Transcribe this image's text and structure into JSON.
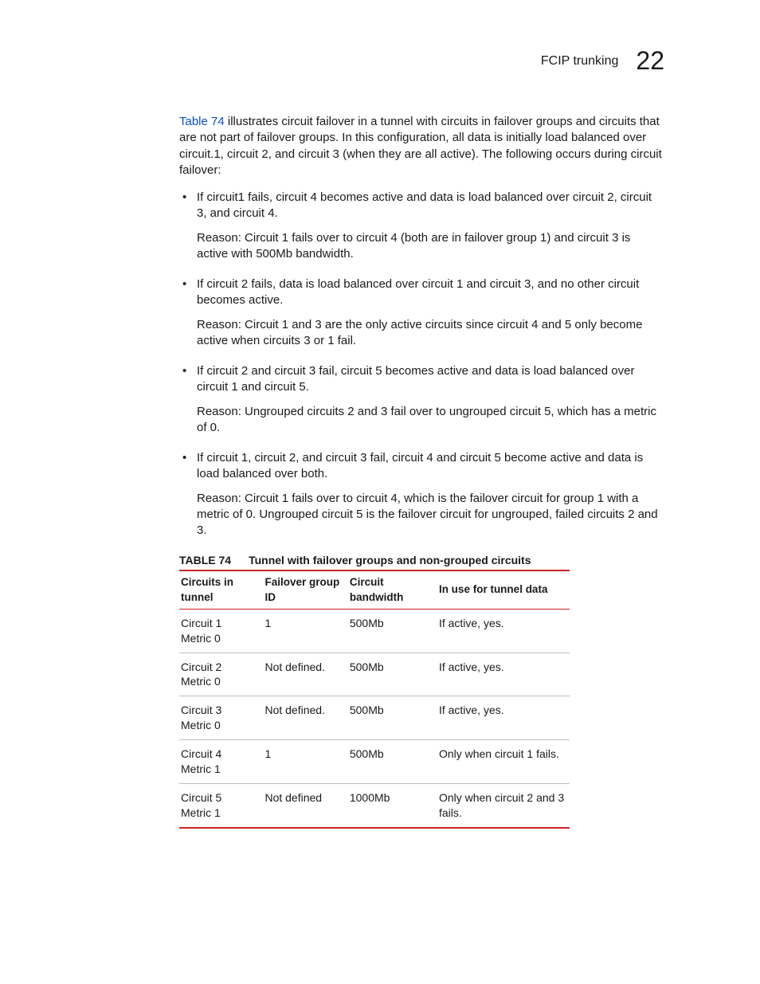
{
  "header": {
    "section": "FCIP trunking",
    "chapter": "22"
  },
  "intro": {
    "link": "Table 74",
    "rest": " illustrates circuit failover in a tunnel with circuits in failover groups and circuits that are not part of failover groups. In this configuration, all data is initially load balanced over circuit.1, circuit 2, and circuit 3 (when they are all active). The following occurs during circuit failover:"
  },
  "bullets": [
    {
      "p1": "If circuit1 fails, circuit 4 becomes active and data is load balanced over circuit 2, circuit 3, and circuit 4.",
      "p2": "Reason: Circuit 1 fails over to circuit 4 (both are in failover group 1) and circuit 3 is active with 500Mb bandwidth."
    },
    {
      "p1": "If circuit 2 fails, data is load balanced over circuit 1 and circuit 3, and no other circuit becomes active.",
      "p2": "Reason: Circuit 1 and 3 are the only active circuits since circuit 4 and 5 only become active when circuits 3 or 1 fail."
    },
    {
      "p1": "If circuit 2 and circuit 3 fail, circuit 5 becomes active and data is load balanced over circuit 1 and circuit 5.",
      "p2": "Reason: Ungrouped circuits 2 and 3 fail over to ungrouped circuit 5, which has a metric of 0."
    },
    {
      "p1": "If circuit 1, circuit 2, and circuit 3 fail, circuit 4 and circuit 5 become active and data is load balanced over both.",
      "p2": "Reason: Circuit 1 fails over to circuit 4, which is the failover circuit for group 1 with a metric of 0. Ungrouped circuit 5 is the failover circuit for ungrouped, failed circuits 2 and 3."
    }
  ],
  "table": {
    "label": "TABLE 74",
    "caption": "Tunnel with failover groups and non-grouped circuits",
    "headers": [
      "Circuits in tunnel",
      "Failover group ID",
      "Circuit bandwidth",
      "In use for tunnel data"
    ],
    "rows": [
      {
        "c0a": "Circuit 1",
        "c0b": "Metric 0",
        "c1": "1",
        "c2": "500Mb",
        "c3": "If active, yes."
      },
      {
        "c0a": "Circuit 2",
        "c0b": "Metric 0",
        "c1": "Not defined.",
        "c2": "500Mb",
        "c3": "If active, yes."
      },
      {
        "c0a": "Circuit 3",
        "c0b": "Metric 0",
        "c1": "Not defined.",
        "c2": "500Mb",
        "c3": "If active, yes."
      },
      {
        "c0a": "Circuit 4",
        "c0b": "Metric 1",
        "c1": "1",
        "c2": "500Mb",
        "c3": "Only when circuit 1 fails."
      },
      {
        "c0a": "Circuit 5",
        "c0b": "Metric 1",
        "c1": "Not defined",
        "c2": "1000Mb",
        "c3": "Only when circuit 2 and 3 fails."
      }
    ]
  }
}
